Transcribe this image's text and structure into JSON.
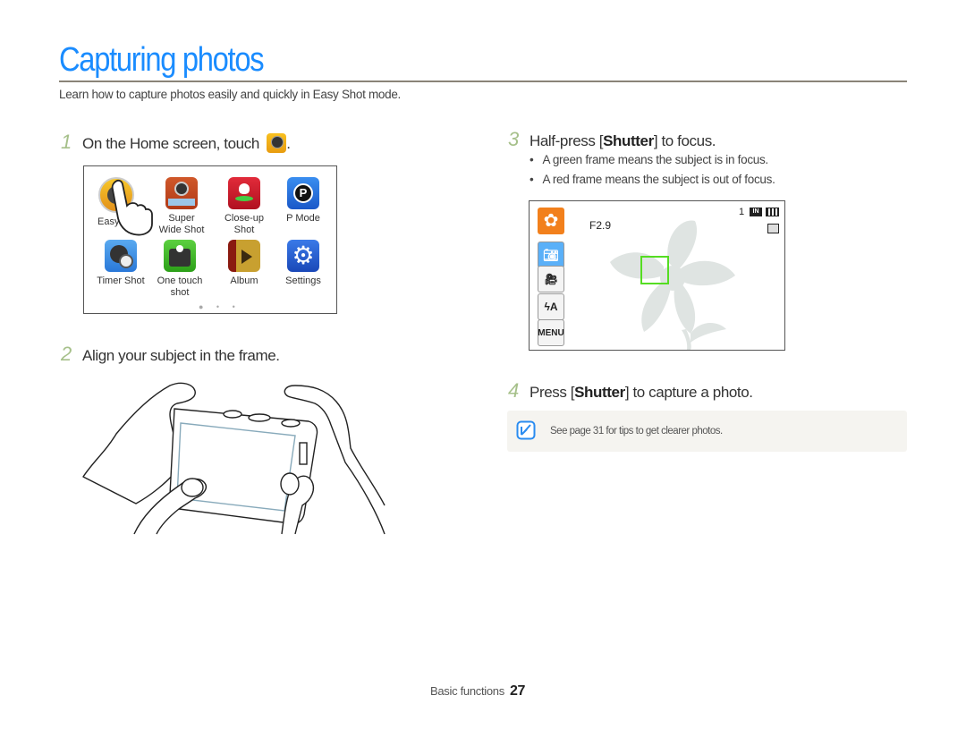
{
  "page": {
    "title": "Capturing photos",
    "intro": "Learn how to capture photos easily and quickly in Easy Shot mode."
  },
  "steps": [
    {
      "num": "1",
      "text": "On the Home screen, touch",
      "suffix": "."
    },
    {
      "num": "2",
      "text": "Align your subject in the frame."
    },
    {
      "num": "3",
      "pre": "Half-press [",
      "key": "Shutter",
      "post": "] to focus.",
      "bullets": [
        "A green frame means the subject is in focus.",
        "A red frame means the subject is out of focus."
      ]
    },
    {
      "num": "4",
      "pre": "Press [",
      "key": "Shutter",
      "post": "] to capture a photo."
    }
  ],
  "home_screen": {
    "apps": [
      {
        "label": "Easy",
        "icon": "easy-shot-icon"
      },
      {
        "label": "Super\nWide Shot",
        "icon": "super-wide-shot-icon"
      },
      {
        "label": "Close-up\nShot",
        "icon": "close-up-shot-icon"
      },
      {
        "label": "P Mode",
        "icon": "p-mode-icon"
      },
      {
        "label": "Timer Shot",
        "icon": "timer-shot-icon"
      },
      {
        "label": "One touch\nshot",
        "icon": "one-touch-shot-icon"
      },
      {
        "label": "Album",
        "icon": "album-icon"
      },
      {
        "label": "Settings",
        "icon": "settings-icon"
      }
    ],
    "page_indicator": "● • •"
  },
  "camera_screen": {
    "aperture": "F2.9",
    "shot_count": "1",
    "storage": "IN",
    "menu_label": "MENU",
    "focus_color": "#55dd22"
  },
  "note": {
    "text": "See page 31 for tips to get clearer photos."
  },
  "footer": {
    "section": "Basic functions",
    "page": "27"
  },
  "colors": {
    "title": "#1a8cff",
    "step_number": "#a6c08a",
    "rule": "#8a8478"
  }
}
